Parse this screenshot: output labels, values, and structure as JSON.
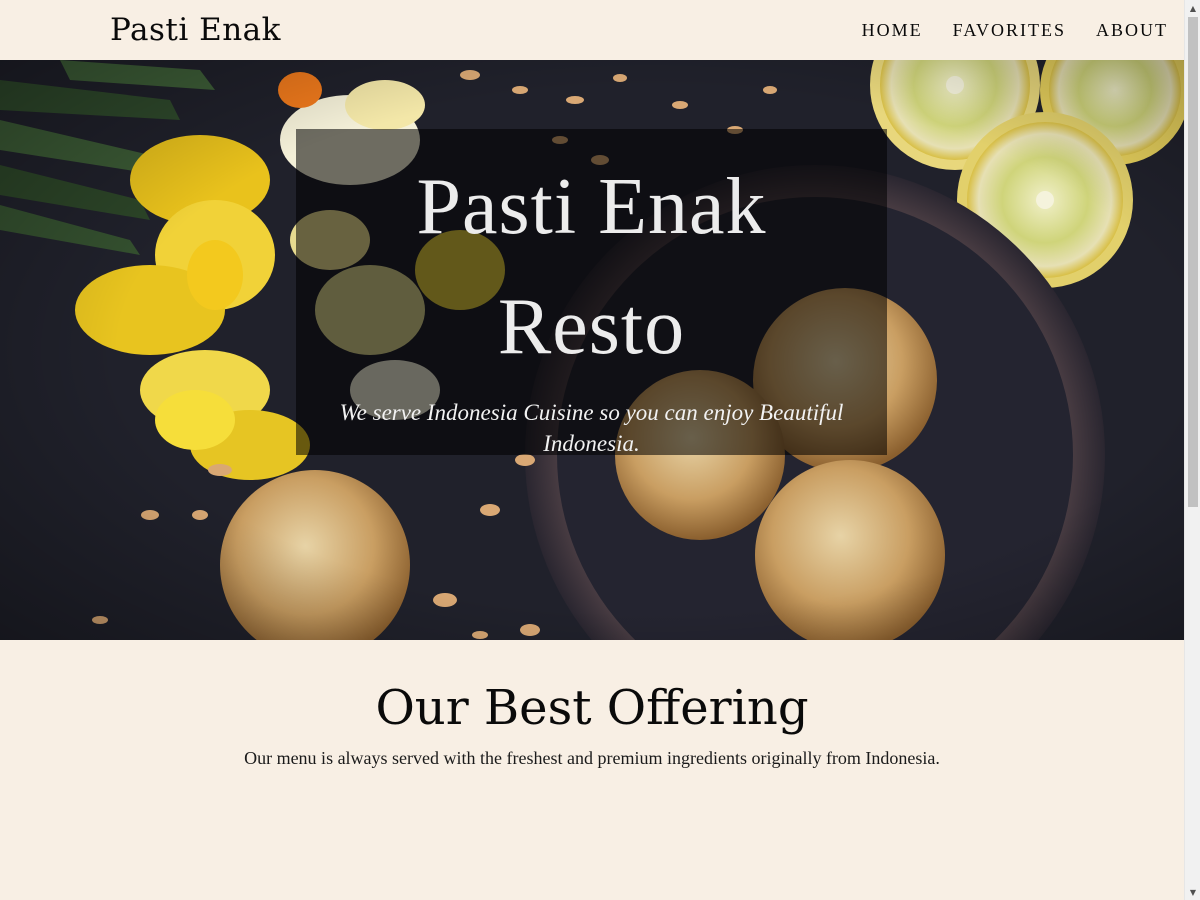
{
  "header": {
    "brand": "Pasti Enak",
    "nav": [
      {
        "label": "HOME"
      },
      {
        "label": "FAVORITES"
      },
      {
        "label": "ABOUT"
      }
    ]
  },
  "hero": {
    "title_line1": "Pasti Enak",
    "title_line2": "Resto",
    "tagline": "We serve Indonesia Cuisine so you can enjoy Beautiful Indonesia."
  },
  "offering": {
    "heading": "Our Best Offering",
    "description": "Our menu is always served with the freshest and premium ingredients originally from Indonesia."
  },
  "scrollbar": {
    "up_icon": "triangle-up-icon",
    "down_icon": "triangle-down-icon",
    "position": 0
  },
  "colors": {
    "background": "#f8efe4",
    "hero_dark": "#1e1f28",
    "overlay": "rgba(0,0,0,0.55)",
    "text_dark": "#0a0a0a",
    "hero_text": "#ececec"
  }
}
